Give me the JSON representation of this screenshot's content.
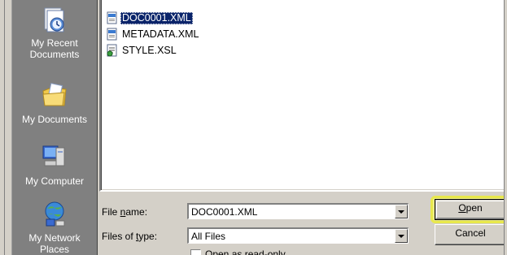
{
  "places": [
    {
      "id": "recent",
      "label": "My Recent Documents",
      "icon": "recent-documents-icon"
    },
    {
      "id": "documents",
      "label": "My Documents",
      "icon": "my-documents-icon"
    },
    {
      "id": "computer",
      "label": "My Computer",
      "icon": "my-computer-icon"
    },
    {
      "id": "network",
      "label": "My Network Places",
      "icon": "network-places-icon"
    }
  ],
  "files": [
    {
      "name": "DOC0001.XML",
      "icon": "xml-file-icon",
      "selected": true
    },
    {
      "name": "METADATA.XML",
      "icon": "xml-file-icon",
      "selected": false
    },
    {
      "name": "STYLE.XSL",
      "icon": "xsl-file-icon",
      "selected": false
    }
  ],
  "form": {
    "file_name_label_pre": "File ",
    "file_name_label_key": "n",
    "file_name_label_post": "ame:",
    "file_name_value": "DOC0001.XML",
    "file_type_label_pre": "Files of ",
    "file_type_label_key": "t",
    "file_type_label_post": "ype:",
    "file_type_value": "All Files",
    "open_key": "O",
    "open_rest": "pen",
    "cancel_label": "Cancel",
    "readonly_label": "Open as read-only"
  },
  "colors": {
    "selection": "#0a246a",
    "highlight": "#e8e84c",
    "places_bg": "#808080"
  }
}
